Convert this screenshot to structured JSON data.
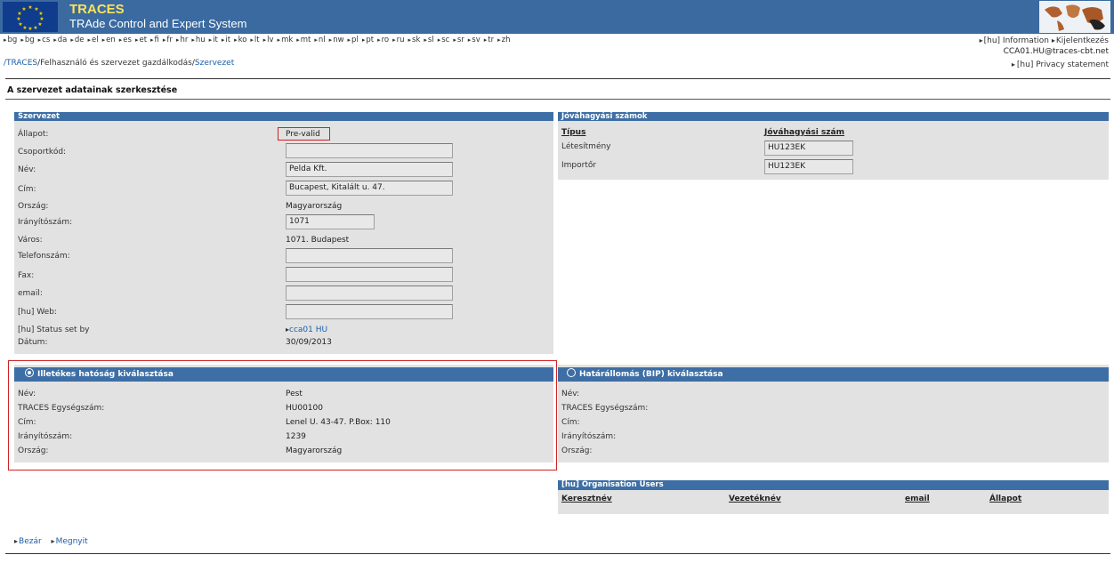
{
  "header": {
    "title": "TRACES",
    "subtitle": "TRAde Control and Expert System"
  },
  "languages": [
    "bg",
    "bg",
    "cs",
    "da",
    "de",
    "el",
    "en",
    "es",
    "et",
    "fi",
    "fr",
    "hr",
    "hu",
    "it",
    "it",
    "ko",
    "lt",
    "lv",
    "mk",
    "mt",
    "nl",
    "nw",
    "pl",
    "pt",
    "ro",
    "ru",
    "sk",
    "sl",
    "sc",
    "sr",
    "sv",
    "tr",
    "zh"
  ],
  "toplinks": {
    "info": "[hu] Information",
    "logout": "Kijelentkezés",
    "user_email": "CCA01.HU@traces-cbt.net",
    "privacy": "[hu] Privacy statement"
  },
  "breadcrumb": {
    "root": "/TRACES",
    "sep1": "/",
    "middle": "Felhasználó és szervezet gazdálkodás",
    "sep2": "/",
    "current": "Szervezet"
  },
  "page_title": "A szervezet adatainak szerkesztése",
  "org_panel": {
    "heading": "Szervezet",
    "labels": {
      "status": "Állapot:",
      "group_code": "Csoportkód:",
      "name": "Név:",
      "address": "Cím:",
      "country": "Ország:",
      "postcode": "Irányítószám:",
      "city": "Város:",
      "phone": "Telefonszám:",
      "fax": "Fax:",
      "email": "email:",
      "web": "[hu] Web:",
      "status_set_by": "[hu] Status set by",
      "date": "Dátum:"
    },
    "values": {
      "status": "Pre-valid",
      "group_code": "",
      "name": "Pelda Kft.",
      "address": "Bucapest, Kitalált u. 47.",
      "country": "Magyarország",
      "postcode": "1071",
      "city": "1071. Budapest",
      "phone": "",
      "fax": "",
      "email": "",
      "web": "",
      "status_set_by": "cca01 HU",
      "date": "30/09/2013"
    }
  },
  "approval_panel": {
    "heading": "Jóváhagyási számok",
    "col_type": "Típus",
    "col_number": "Jóváhagyási szám",
    "rows": [
      {
        "type": "Létesítmény",
        "number": "HU123EK"
      },
      {
        "type": "Importőr",
        "number": "HU123EK"
      }
    ]
  },
  "authority": {
    "heading": "Illetékes hatóság kiválasztása",
    "labels": {
      "name": "Név:",
      "unit": "TRACES Egységszám:",
      "address": "Cím:",
      "postcode": "Irányítószám:",
      "country": "Ország:"
    },
    "values": {
      "name": "Pest",
      "unit": "HU00100",
      "address": "Lenel U. 43-47. P.Box: 110",
      "postcode": "1239",
      "country": "Magyarország"
    }
  },
  "bip": {
    "heading": "Határállomás (BIP) kiválasztása",
    "labels": {
      "name": "Név:",
      "unit": "TRACES Egységszám:",
      "address": "Cím:",
      "postcode": "Irányítószám:",
      "country": "Ország:"
    }
  },
  "org_users": {
    "heading": "[hu] Organisation Users",
    "col_first": "Keresztnév",
    "col_last": "Vezetéknév",
    "col_email": "email",
    "col_status": "Állapot"
  },
  "footer": {
    "close": "Bezár",
    "open": "Megnyit"
  },
  "colors": {
    "banner": "#3a6aa0",
    "panel_head": "#3d6ea5",
    "panel_bg": "#e2e2e2",
    "highlight": "#d42020"
  }
}
